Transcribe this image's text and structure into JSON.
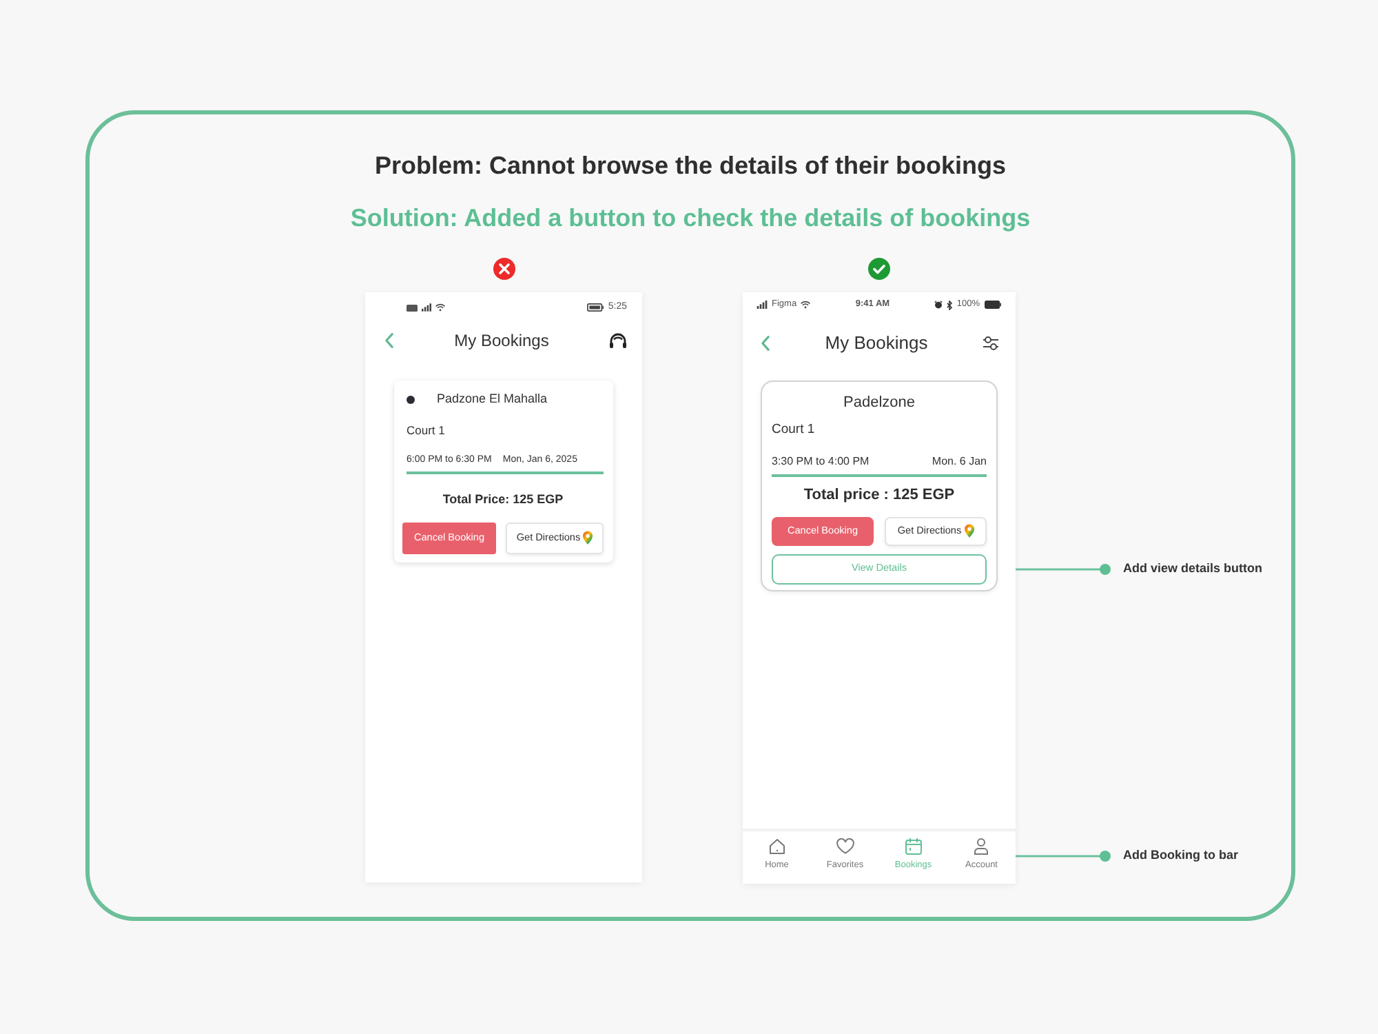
{
  "problem": "Problem: Cannot browse the details of their bookings",
  "solution": "Solution: Added a button to check the details of bookings",
  "screens": [
    {
      "kind": "before",
      "approved": false,
      "status_bar": {
        "time": "5:25"
      },
      "title": "My Bookings",
      "booking": {
        "venue": "Padzone El Mahalla",
        "court": "Court 1",
        "time": "6:00 PM to 6:30 PM",
        "date": "Mon, Jan 6, 2025",
        "total": "Total Price: 125 EGP",
        "buttons": [
          {
            "kind": "cancel",
            "label": "Cancel Booking"
          },
          {
            "kind": "directions",
            "label": "Get Directions"
          }
        ]
      }
    },
    {
      "kind": "after",
      "approved": true,
      "status_bar": {
        "carrier": "Figma",
        "time": "9:41 AM",
        "battery": "100%"
      },
      "title": "My Bookings",
      "booking": {
        "venue": "Padelzone",
        "court": "Court 1",
        "time": "3:30 PM to 4:00 PM",
        "date": "Mon. 6 Jan",
        "total": "Total price : 125 EGP",
        "buttons": [
          {
            "kind": "cancel",
            "label": "Cancel Booking"
          },
          {
            "kind": "directions",
            "label": "Get Directions"
          },
          {
            "kind": "details",
            "label": "View Details",
            "annotation": "Add view details button"
          }
        ]
      },
      "nav_bar": {
        "items": [
          {
            "kind": "home",
            "label": "Home",
            "selected": false
          },
          {
            "kind": "favorites",
            "label": "Favorites",
            "selected": false
          },
          {
            "kind": "bookings",
            "label": "Bookings",
            "selected": true
          },
          {
            "kind": "account",
            "label": "Account",
            "selected": false
          }
        ],
        "annotation": "Add Booking to bar"
      }
    }
  ]
}
